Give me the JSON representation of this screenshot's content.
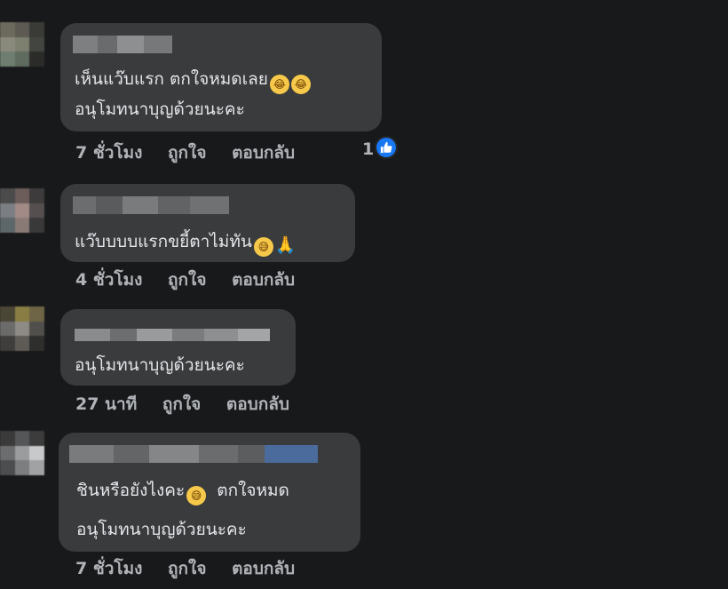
{
  "comments": [
    {
      "lines": [
        "เห็นแว๊บแรก ตกใจหมดเลย",
        "อนุโมทนาบุญด้วยนะคะ"
      ],
      "line1_emoji": [
        "😂",
        "😂"
      ],
      "time": "7 ชั่วโมง",
      "like_label": "ถูกใจ",
      "reply_label": "ตอบกลับ",
      "reaction_count": "1"
    },
    {
      "lines": [
        "แว๊บบบบแรกขยี้ตาไม่ทัน"
      ],
      "line1_emoji": [
        "😅",
        "🙏"
      ],
      "time": "4 ชั่วโมง",
      "like_label": "ถูกใจ",
      "reply_label": "ตอบกลับ"
    },
    {
      "lines": [
        "อนุโมทนาบุญด้วยนะคะ"
      ],
      "time": "27 นาที",
      "like_label": "ถูกใจ",
      "reply_label": "ตอบกลับ"
    },
    {
      "lines": [
        "ชินหรือยังไงคะ",
        "ตกใจหมด",
        "อนุโมทนาบุญด้วยนะคะ"
      ],
      "line1_emoji": [
        "😅"
      ],
      "time": "7 ชั่วโมง",
      "like_label": "ถูกใจ",
      "reply_label": "ตอบกลับ"
    }
  ],
  "colors": {
    "background": "#18191a",
    "bubble": "#3a3b3c",
    "text": "#e4e6eb",
    "meta": "#b0b3b8",
    "like_badge": "#1877f2"
  },
  "icons": {
    "reaction": "thumbs-up-icon",
    "avatar": "pixelated-avatar"
  }
}
